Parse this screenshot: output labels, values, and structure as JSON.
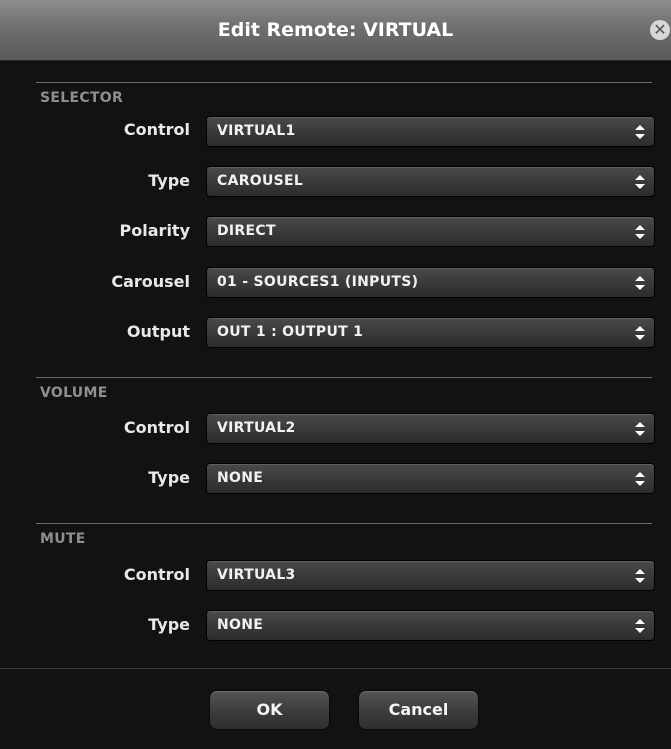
{
  "dialog": {
    "title": "Edit Remote: VIRTUAL",
    "close_icon": "close-icon"
  },
  "sections": {
    "selector": {
      "label": "SELECTOR",
      "rows": [
        {
          "label": "Control",
          "value": "VIRTUAL1"
        },
        {
          "label": "Type",
          "value": "CAROUSEL"
        },
        {
          "label": "Polarity",
          "value": "DIRECT"
        },
        {
          "label": "Carousel",
          "value": "01 - SOURCES1 (INPUTS)"
        },
        {
          "label": "Output",
          "value": "OUT 1 : OUTPUT 1"
        }
      ]
    },
    "volume": {
      "label": "VOLUME",
      "rows": [
        {
          "label": "Control",
          "value": "VIRTUAL2"
        },
        {
          "label": "Type",
          "value": "NONE"
        }
      ]
    },
    "mute": {
      "label": "MUTE",
      "rows": [
        {
          "label": "Control",
          "value": "VIRTUAL3"
        },
        {
          "label": "Type",
          "value": "NONE"
        }
      ]
    }
  },
  "buttons": {
    "ok": "OK",
    "cancel": "Cancel"
  },
  "colors": {
    "background": "#121212",
    "titlebar": "#7a7a7a",
    "section_label": "#8f8f8f",
    "text": "#e8e8e8"
  }
}
